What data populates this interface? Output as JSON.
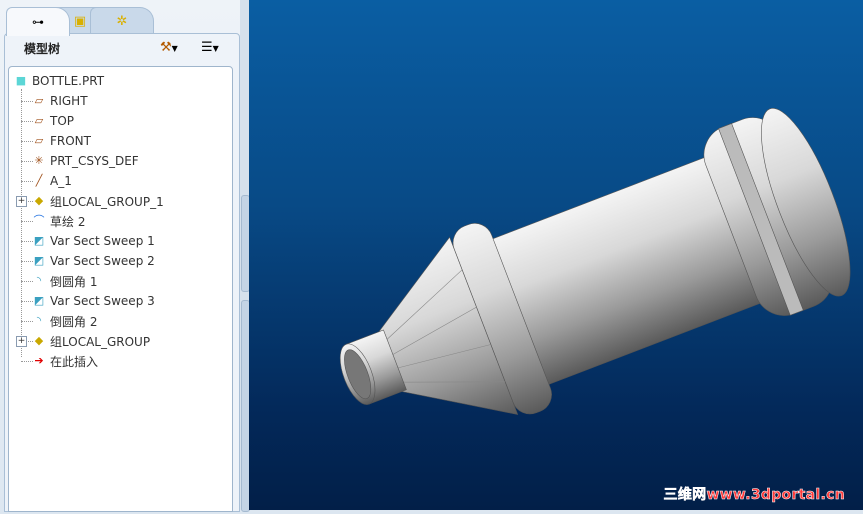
{
  "tabs": [
    {
      "name": "model-tree",
      "icon": "tree-icon"
    },
    {
      "name": "folder-browser",
      "icon": "folders-icon"
    },
    {
      "name": "favorites",
      "icon": "favorites-folder-icon"
    }
  ],
  "panel": {
    "title": "模型树",
    "settings_icon": "settings-tools-icon",
    "show_icon": "show-list-icon"
  },
  "tree": [
    {
      "label": "BOTTLE.PRT",
      "icon": "part-icon"
    },
    {
      "label": "RIGHT",
      "icon": "datum-plane-icon"
    },
    {
      "label": "TOP",
      "icon": "datum-plane-icon"
    },
    {
      "label": "FRONT",
      "icon": "datum-plane-icon"
    },
    {
      "label": "PRT_CSYS_DEF",
      "icon": "csys-icon"
    },
    {
      "label": "A_1",
      "icon": "axis-icon"
    },
    {
      "label": "组LOCAL_GROUP_1",
      "icon": "group-icon",
      "expandable": true
    },
    {
      "label": "草绘 2",
      "icon": "sketch-icon"
    },
    {
      "label": "Var Sect Sweep 1",
      "icon": "sweep-icon"
    },
    {
      "label": "Var Sect Sweep 2",
      "icon": "sweep-icon"
    },
    {
      "label": "倒圆角 1",
      "icon": "round-icon"
    },
    {
      "label": "Var Sect Sweep 3",
      "icon": "sweep-icon"
    },
    {
      "label": "倒圆角 2",
      "icon": "round-icon"
    },
    {
      "label": "组LOCAL_GROUP",
      "icon": "group-icon",
      "expandable": true
    },
    {
      "label": "在此插入",
      "icon": "insert-here-arrow-icon"
    }
  ],
  "watermark": "三维网www.3dportal.cn"
}
